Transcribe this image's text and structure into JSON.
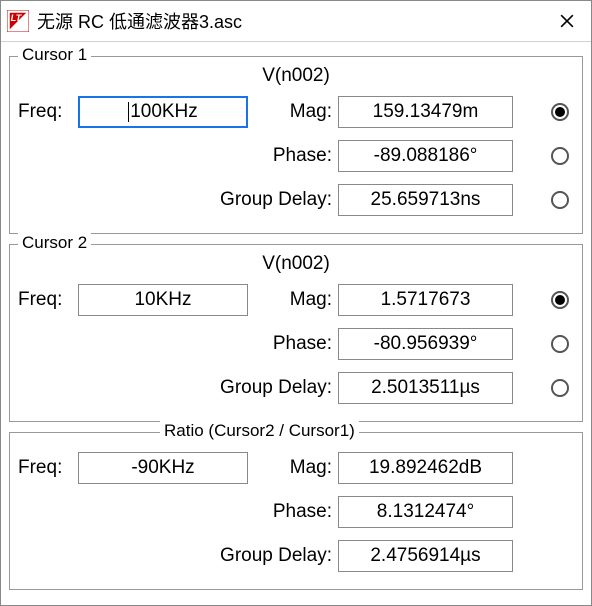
{
  "window": {
    "title": "无源 RC 低通滤波器3.asc"
  },
  "cursor1": {
    "legend": "Cursor 1",
    "signal": "V(n002)",
    "freq_label": "Freq:",
    "freq_value": "100KHz",
    "mag_label": "Mag:",
    "mag_value": "159.13479m",
    "mag_selected": true,
    "phase_label": "Phase:",
    "phase_value": "-89.088186°",
    "phase_selected": false,
    "gd_label": "Group Delay:",
    "gd_value": "25.659713ns",
    "gd_selected": false
  },
  "cursor2": {
    "legend": "Cursor 2",
    "signal": "V(n002)",
    "freq_label": "Freq:",
    "freq_value": "10KHz",
    "mag_label": "Mag:",
    "mag_value": "1.5717673",
    "mag_selected": true,
    "phase_label": "Phase:",
    "phase_value": "-80.956939°",
    "phase_selected": false,
    "gd_label": "Group Delay:",
    "gd_value": "2.5013511µs",
    "gd_selected": false
  },
  "ratio": {
    "legend": "Ratio (Cursor2 / Cursor1)",
    "freq_label": "Freq:",
    "freq_value": "-90KHz",
    "mag_label": "Mag:",
    "mag_value": "19.892462dB",
    "phase_label": "Phase:",
    "phase_value": "8.1312474°",
    "gd_label": "Group Delay:",
    "gd_value": "2.4756914µs"
  }
}
